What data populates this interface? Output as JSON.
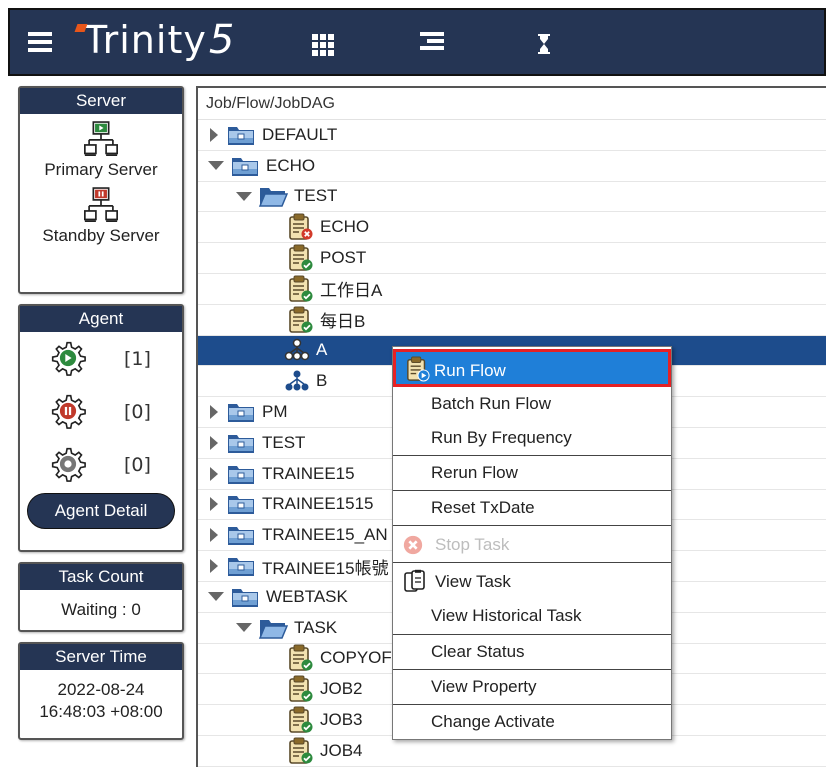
{
  "app": {
    "logo_text": "Trinity",
    "logo_number": "5"
  },
  "colors": {
    "navy": "#253554",
    "selected_row": "#1d4c8c",
    "menu_highlight": "#1f7fd8",
    "highlight_border": "#e52124"
  },
  "toolbar": {
    "menu_icon": "hamburger-icon",
    "icons": [
      "grid-icon",
      "list-icon",
      "hourglass-icon"
    ]
  },
  "server": {
    "title": "Server",
    "primary_label": "Primary Server",
    "standby_label": "Standby Server"
  },
  "agent": {
    "title": "Agent",
    "running_count": "[1]",
    "stopped_count": "[0]",
    "idle_count": "[0]",
    "detail_button": "Agent Detail"
  },
  "task_count": {
    "title": "Task Count",
    "waiting": "Waiting : 0"
  },
  "server_time": {
    "title": "Server Time",
    "date": "2022-08-24",
    "time": "16:48:03 +08:00"
  },
  "tree": {
    "header": "Job/Flow/JobDAG",
    "rows": [
      {
        "label": "DEFAULT"
      },
      {
        "label": "ECHO"
      },
      {
        "label": "TEST"
      },
      {
        "label": "ECHO"
      },
      {
        "label": "POST"
      },
      {
        "label": "工作日A"
      },
      {
        "label": "每日B"
      },
      {
        "label": "A"
      },
      {
        "label": "B"
      },
      {
        "label": "PM"
      },
      {
        "label": "TEST"
      },
      {
        "label": "TRAINEE15"
      },
      {
        "label": "TRAINEE1515"
      },
      {
        "label": "TRAINEE15_AN"
      },
      {
        "label": "TRAINEE15帳號"
      },
      {
        "label": "WEBTASK"
      },
      {
        "label": "TASK"
      },
      {
        "label": "COPYOFJOBS"
      },
      {
        "label": "JOB2"
      },
      {
        "label": "JOB3"
      },
      {
        "label": "JOB4"
      }
    ]
  },
  "context_menu": {
    "run_flow": "Run Flow",
    "batch_run_flow": "Batch Run Flow",
    "run_by_frequency": "Run By Frequency",
    "rerun_flow": "Rerun Flow",
    "reset_txdate": "Reset TxDate",
    "stop_task": "Stop Task",
    "view_task": "View Task",
    "view_historical_task": "View Historical Task",
    "clear_status": "Clear Status",
    "view_property": "View Property",
    "change_activate": "Change Activate"
  }
}
